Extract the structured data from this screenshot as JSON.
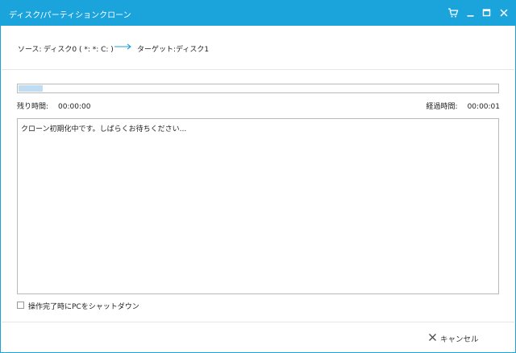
{
  "window": {
    "title": "ディスク/パーティションクローン",
    "accent_color": "#1ba3dc"
  },
  "titlebar_icons": [
    "cart-icon",
    "minimize-icon",
    "maximize-icon",
    "close-icon"
  ],
  "clone": {
    "source_label": "ソース:",
    "source_value": "ディスク0 ( *: *: C: )",
    "target_label": "ターゲット:",
    "target_value": "ディスク1"
  },
  "progress": {
    "percent": 5
  },
  "times": {
    "remaining_label": "残り時間:",
    "remaining_value": "00:00:00",
    "elapsed_label": "経過時間:",
    "elapsed_value": "00:00:01"
  },
  "log": {
    "message": "クローン初期化中です。しばらくお待ちください..."
  },
  "shutdown_option": {
    "label": "操作完了時にPCをシャットダウン",
    "checked": false
  },
  "footer": {
    "cancel_label": "キャンセル"
  }
}
